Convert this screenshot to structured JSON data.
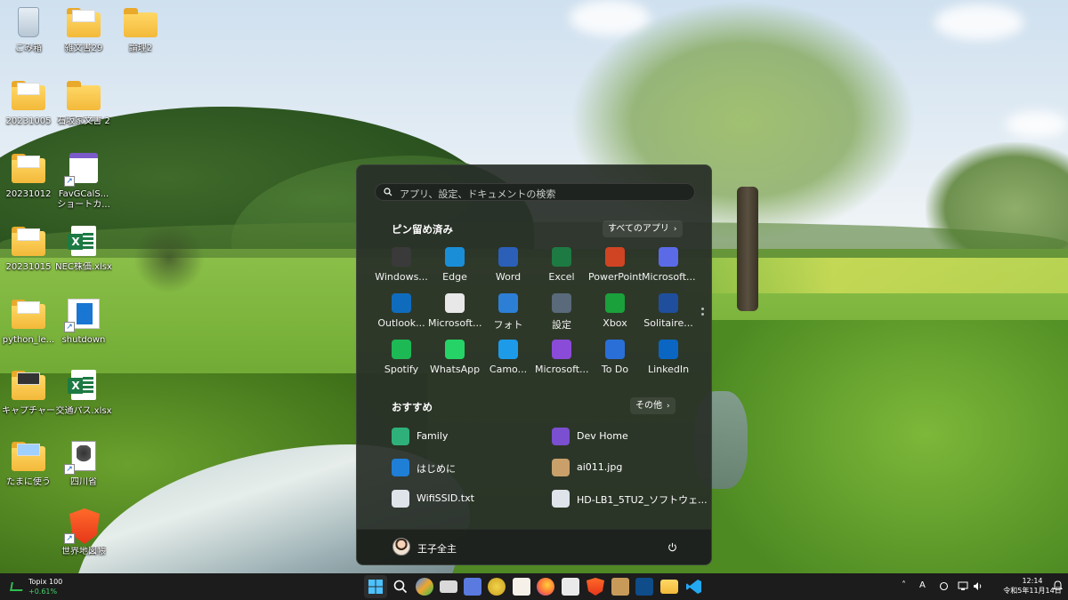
{
  "desktop": {
    "icons": [
      {
        "id": "recycle",
        "label": "ごみ箱"
      },
      {
        "id": "f1",
        "label": "雑文書29"
      },
      {
        "id": "f2",
        "label": "論理2"
      },
      {
        "id": "f3",
        "label": "20231005"
      },
      {
        "id": "f4",
        "label": "石坂家文書 2"
      },
      {
        "id": "f5",
        "label": "20231012"
      },
      {
        "id": "f6",
        "label": "FavGCalS... ショートカ..."
      },
      {
        "id": "f7",
        "label": "20231015"
      },
      {
        "id": "f8",
        "label": "NEC株価.xlsx"
      },
      {
        "id": "f9",
        "label": "python_le..."
      },
      {
        "id": "f10",
        "label": "shutdown"
      },
      {
        "id": "f11",
        "label": "キャプチャー"
      },
      {
        "id": "f12",
        "label": "交通パス.xlsx"
      },
      {
        "id": "f13",
        "label": "たまに使う"
      },
      {
        "id": "f14",
        "label": "四川省"
      },
      {
        "id": "f15",
        "label": "世界地図帳"
      }
    ]
  },
  "start_menu": {
    "search_placeholder": "アプリ、設定、ドキュメントの検索",
    "pinned_title": "ピン留め済み",
    "all_apps_label": "すべてのアプリ",
    "pinned": [
      {
        "label": "Windows...",
        "color": "#3a3a3a"
      },
      {
        "label": "Edge",
        "color": "#1a8fd8"
      },
      {
        "label": "Word",
        "color": "#2b5fb8"
      },
      {
        "label": "Excel",
        "color": "#1d7a43"
      },
      {
        "label": "PowerPoint",
        "color": "#d04423"
      },
      {
        "label": "Microsoft...",
        "color": "#5b6be8"
      },
      {
        "label": "Outlook...",
        "color": "#0f6cbd"
      },
      {
        "label": "Microsoft...",
        "color": "#e8e8e8"
      },
      {
        "label": "フォト",
        "color": "#2d7fd6"
      },
      {
        "label": "設定",
        "color": "#5a6a7a"
      },
      {
        "label": "Xbox",
        "color": "#1aa13c"
      },
      {
        "label": "Solitaire...",
        "color": "#1f4f9c"
      },
      {
        "label": "Spotify",
        "color": "#1db954"
      },
      {
        "label": "WhatsApp",
        "color": "#25d366"
      },
      {
        "label": "Camo...",
        "color": "#1e9be8"
      },
      {
        "label": "Microsoft...",
        "color": "#8a4bd8"
      },
      {
        "label": "To Do",
        "color": "#2a6fd8"
      },
      {
        "label": "LinkedIn",
        "color": "#0a66c2"
      }
    ],
    "recommended_title": "おすすめ",
    "more_label": "その他",
    "recommended": [
      {
        "label": "Family",
        "color": "#2fb07a"
      },
      {
        "label": "Dev Home",
        "color": "#7a4fd0"
      },
      {
        "label": "はじめに",
        "color": "#1f7fd6"
      },
      {
        "label": "ai011.jpg",
        "color": "#c9a06a"
      },
      {
        "label": "WifiSSID.txt",
        "color": "#dfe3ea"
      },
      {
        "label": "HD-LB1_5TU2_ソフトウェ...",
        "color": "#dfe3ea"
      }
    ],
    "user_name": "王子全主"
  },
  "taskbar": {
    "widget_title": "Topix 100",
    "widget_value": "+0.61%",
    "tray_ime": "A",
    "time": "12:14",
    "date": "令和5年11月14日"
  }
}
